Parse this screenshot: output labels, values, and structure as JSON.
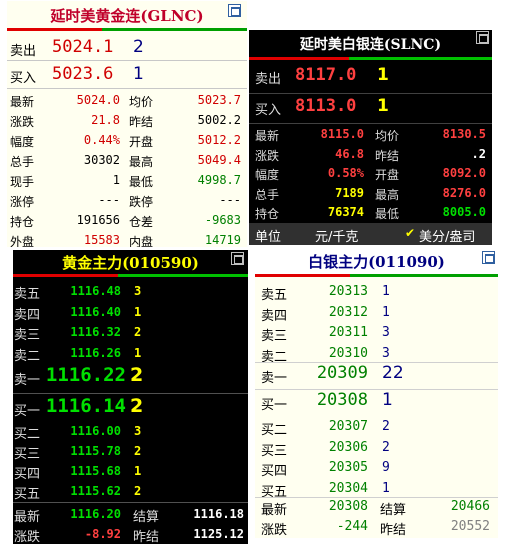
{
  "gold_intl": {
    "title": "延时美黄金连(GLNC)",
    "sell_label": "卖出",
    "sell_price": "5024.1",
    "sell_qty": "2",
    "buy_label": "买入",
    "buy_price": "5023.6",
    "buy_qty": "1",
    "rows": [
      {
        "l1": "最新",
        "v1": "5024.0",
        "l2": "均价",
        "v2": "5023.7"
      },
      {
        "l1": "涨跌",
        "v1": "21.8",
        "l2": "昨结",
        "v2": "5002.2"
      },
      {
        "l1": "幅度",
        "v1": "0.44%",
        "l2": "开盘",
        "v2": "5012.2"
      },
      {
        "l1": "总手",
        "v1": "30302",
        "l2": "最高",
        "v2": "5049.4"
      },
      {
        "l1": "现手",
        "v1": "1",
        "l2": "最低",
        "v2": "4998.7"
      },
      {
        "l1": "涨停",
        "v1": "---",
        "l2": "跌停",
        "v2": "---"
      },
      {
        "l1": "持仓",
        "v1": "191656",
        "l2": "仓差",
        "v2": "-9683"
      },
      {
        "l1": "外盘",
        "v1": "15583",
        "l2": "内盘",
        "v2": "14719"
      }
    ]
  },
  "silver_intl": {
    "title": "延时美白银连(SLNC)",
    "sell_label": "卖出",
    "sell_price": "8117.0",
    "sell_qty": "1",
    "buy_label": "买入",
    "buy_price": "8113.0",
    "buy_qty": "1",
    "rows": [
      {
        "l1": "最新",
        "v1": "8115.0",
        "l2": "均价",
        "v2": "8130.5"
      },
      {
        "l1": "涨跌",
        "v1": "46.8",
        "l2": "昨结",
        "v2": ".2"
      },
      {
        "l1": "幅度",
        "v1": "0.58%",
        "l2": "开盘",
        "v2": "8092.0"
      },
      {
        "l1": "总手",
        "v1": "7189",
        "l2": "最高",
        "v2": "8276.0"
      },
      {
        "l1": "持仓",
        "v1": "76374",
        "l2": "最低",
        "v2": "8005.0"
      }
    ],
    "unit_label": "单位",
    "unit_value": "元/千克",
    "unit_option": "美分/盎司",
    "check_mark": "✔"
  },
  "gold_main": {
    "title": "黄金主力(010590)",
    "asks": [
      {
        "label": "卖五",
        "price": "1116.48",
        "qty": "3"
      },
      {
        "label": "卖四",
        "price": "1116.40",
        "qty": "1"
      },
      {
        "label": "卖三",
        "price": "1116.32",
        "qty": "2"
      },
      {
        "label": "卖二",
        "price": "1116.26",
        "qty": "1"
      }
    ],
    "ask1": {
      "label": "卖一",
      "price": "1116.22",
      "qty": "2"
    },
    "bid1": {
      "label": "买一",
      "price": "1116.14",
      "qty": "2"
    },
    "bids": [
      {
        "label": "买二",
        "price": "1116.00",
        "qty": "3"
      },
      {
        "label": "买三",
        "price": "1115.78",
        "qty": "2"
      },
      {
        "label": "买四",
        "price": "1115.68",
        "qty": "1"
      },
      {
        "label": "买五",
        "price": "1115.62",
        "qty": "2"
      }
    ],
    "footer": [
      {
        "l1": "最新",
        "v1": "1116.20",
        "l2": "结算",
        "v2": "1116.18"
      },
      {
        "l1": "涨跌",
        "v1": "-8.92",
        "l2": "昨结",
        "v2": "1125.12"
      }
    ]
  },
  "silver_main": {
    "title": "白银主力(011090)",
    "asks": [
      {
        "label": "卖五",
        "price": "20313",
        "qty": "1"
      },
      {
        "label": "卖四",
        "price": "20312",
        "qty": "1"
      },
      {
        "label": "卖三",
        "price": "20311",
        "qty": "3"
      },
      {
        "label": "卖二",
        "price": "20310",
        "qty": "3"
      }
    ],
    "ask1": {
      "label": "卖一",
      "price": "20309",
      "qty": "22"
    },
    "bid1": {
      "label": "买一",
      "price": "20308",
      "qty": "1"
    },
    "bids": [
      {
        "label": "买二",
        "price": "20307",
        "qty": "2"
      },
      {
        "label": "买三",
        "price": "20306",
        "qty": "2"
      },
      {
        "label": "买四",
        "price": "20305",
        "qty": "9"
      },
      {
        "label": "买五",
        "price": "20304",
        "qty": "1"
      }
    ],
    "footer": [
      {
        "l1": "最新",
        "v1": "20308",
        "l2": "结算",
        "v2": "20466"
      },
      {
        "l1": "涨跌",
        "v1": "-244",
        "l2": "昨结",
        "v2": "20552"
      }
    ]
  },
  "colors": {
    "up": "#d00000",
    "down": "#008000",
    "dark_up": "#ff4040",
    "dark_down": "#00e000",
    "dark_qty": "#ffff00"
  }
}
